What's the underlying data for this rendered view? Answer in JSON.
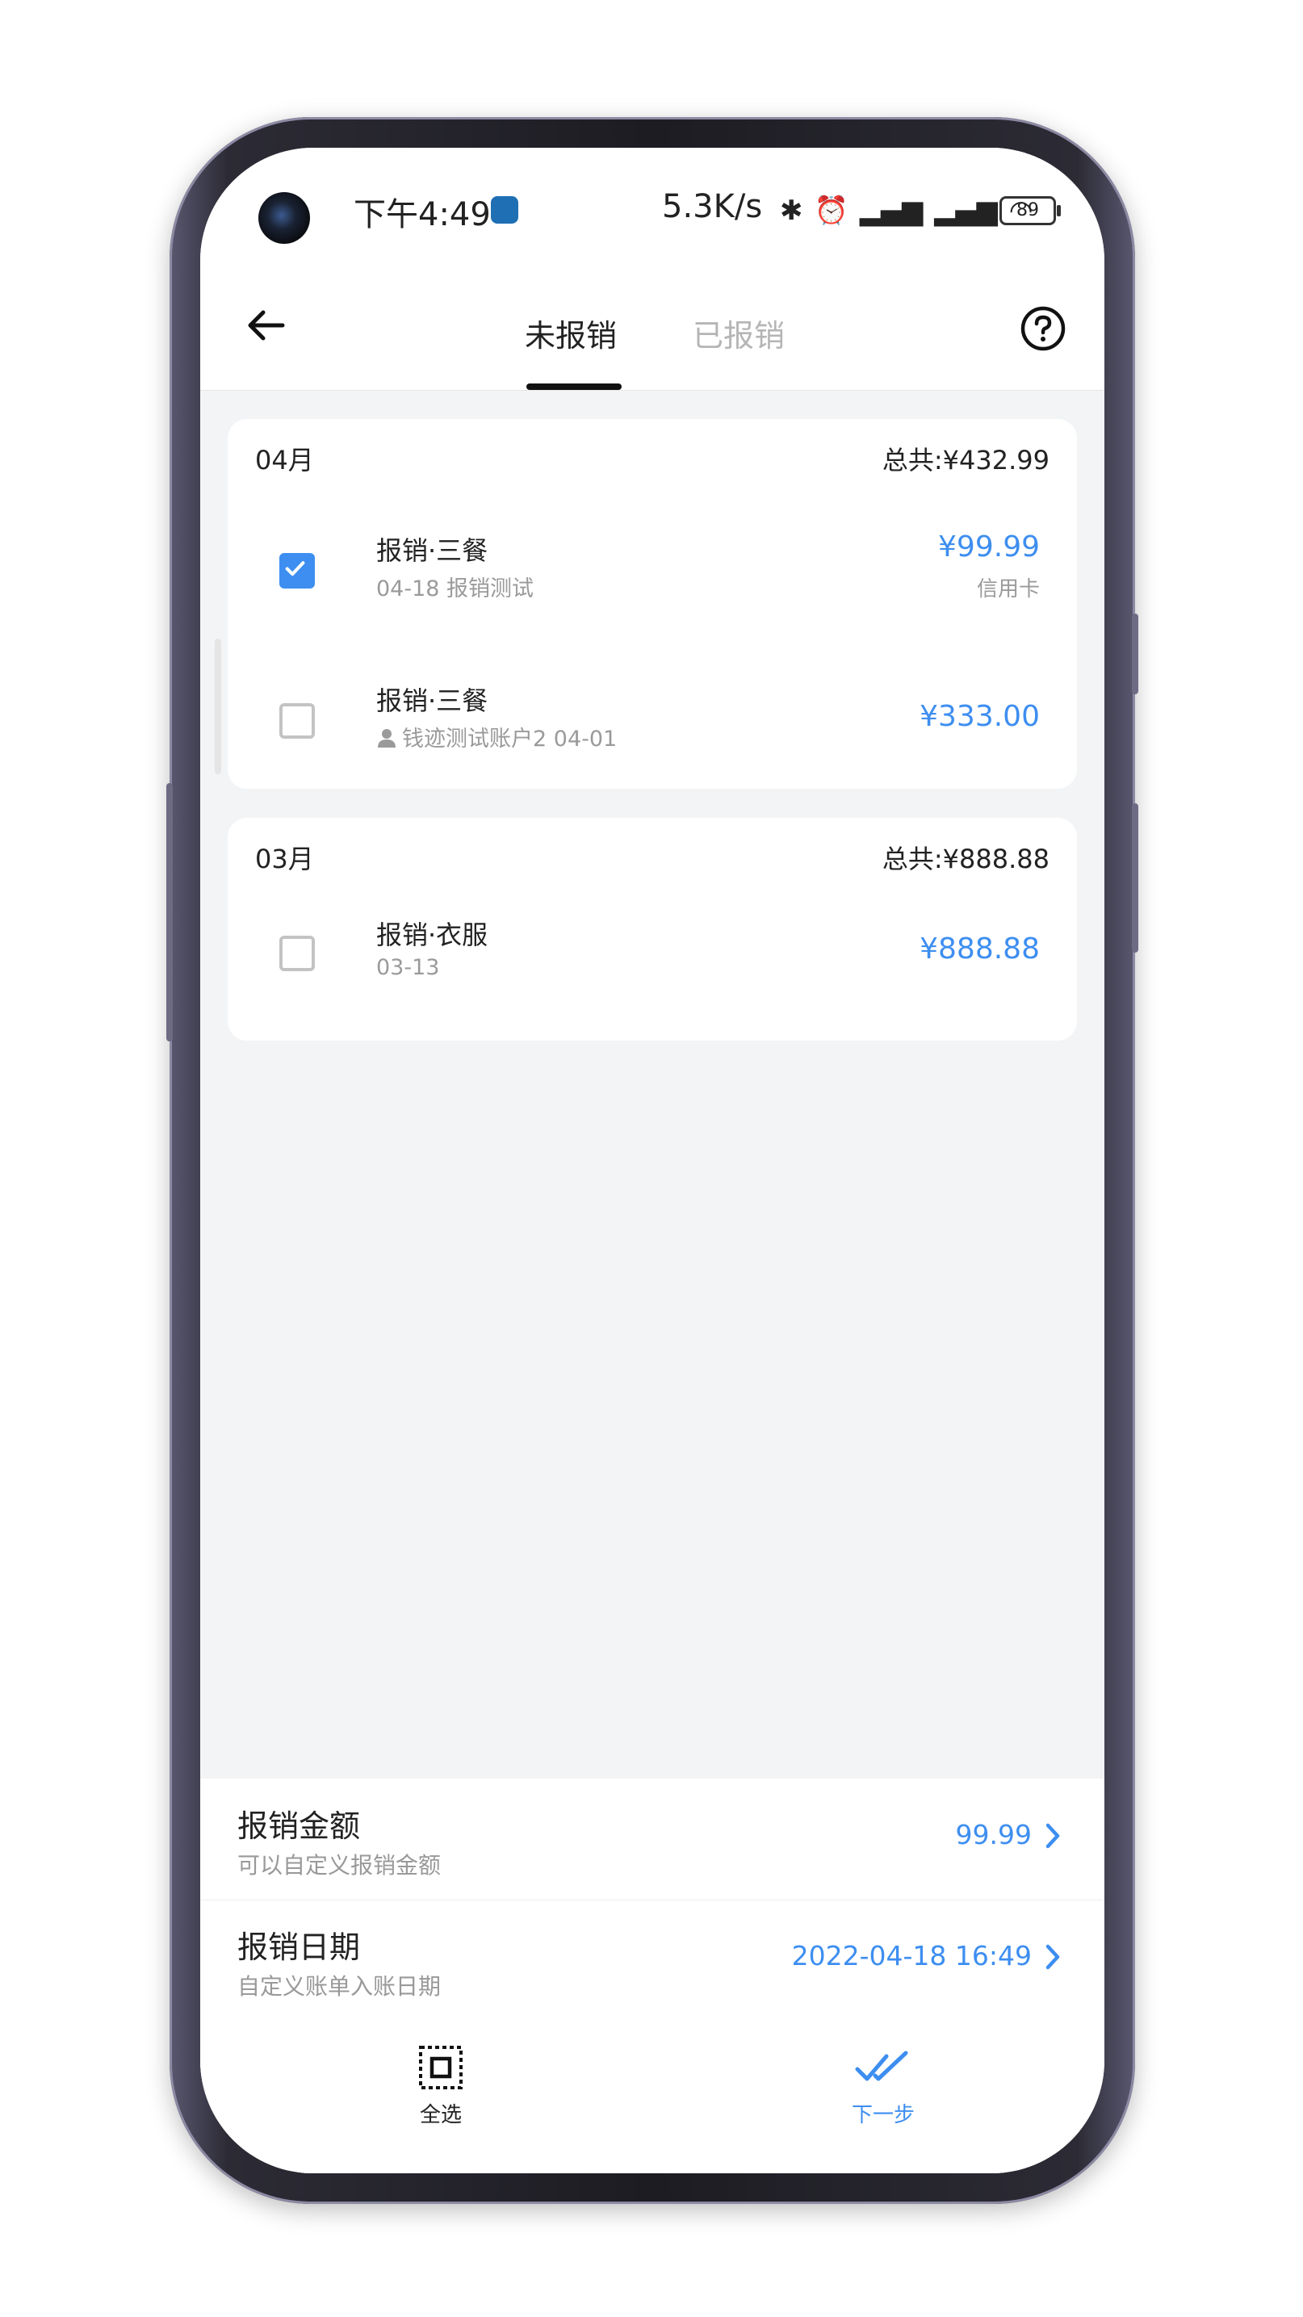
{
  "status_bar": {
    "time": "下午4:49",
    "speed": "5.3K/s",
    "battery": "89"
  },
  "header": {
    "tabs": [
      {
        "label": "未报销",
        "active": true
      },
      {
        "label": "已报销",
        "active": false
      }
    ]
  },
  "groups": [
    {
      "month": "04月",
      "total": "总共:¥432.99",
      "items": [
        {
          "checked": true,
          "title": "报销·三餐",
          "subtitle": "04-18 报销测试",
          "amount": "¥99.99",
          "method": "信用卡",
          "has_user_icon": false
        },
        {
          "checked": false,
          "title": "报销·三餐",
          "subtitle": "钱迹测试账户2 04-01",
          "amount": "¥333.00",
          "method": "",
          "has_user_icon": true
        }
      ]
    },
    {
      "month": "03月",
      "total": "总共:¥888.88",
      "items": [
        {
          "checked": false,
          "title": "报销·衣服",
          "subtitle": "03-13",
          "amount": "¥888.88",
          "method": "",
          "has_user_icon": false
        }
      ]
    }
  ],
  "settings": {
    "amount": {
      "title": "报销金额",
      "subtitle": "可以自定义报销金额",
      "value": "99.99"
    },
    "date": {
      "title": "报销日期",
      "subtitle": "自定义账单入账日期",
      "value": "2022-04-18 16:49"
    }
  },
  "bottom_bar": {
    "select_all": "全选",
    "next": "下一步"
  },
  "colors": {
    "accent": "#3d8ef0",
    "background": "#f3f4f6"
  }
}
